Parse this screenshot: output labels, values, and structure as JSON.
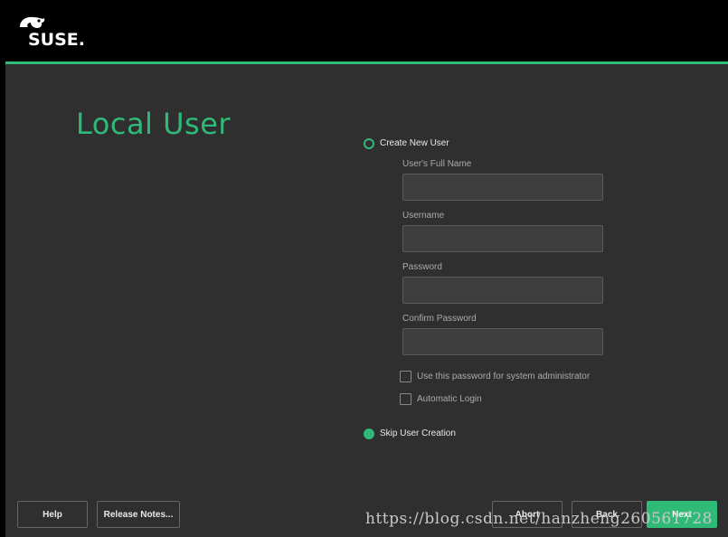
{
  "header": {
    "logo_text": "SUSE."
  },
  "page": {
    "title": "Local User"
  },
  "options": {
    "create_new_user": {
      "label": "Create New User",
      "selected": false
    },
    "skip_user_creation": {
      "label": "Skip User Creation",
      "selected": true
    }
  },
  "form": {
    "full_name": {
      "label": "User's Full Name",
      "value": ""
    },
    "username": {
      "label": "Username",
      "value": ""
    },
    "password": {
      "label": "Password",
      "value": ""
    },
    "confirm_password": {
      "label": "Confirm Password",
      "value": ""
    },
    "use_for_admin": {
      "label": "Use this password for system administrator",
      "checked": false
    },
    "automatic_login": {
      "label": "Automatic Login",
      "checked": false
    }
  },
  "buttons": {
    "help": "Help",
    "release_notes": "Release Notes...",
    "abort": "Abort",
    "back": "Back",
    "next": "Next"
  },
  "watermark": "https://blog.csdn.net/hanzheng260561728",
  "colors": {
    "accent": "#30ba78",
    "background": "#2f2f2f",
    "header": "#000000"
  }
}
